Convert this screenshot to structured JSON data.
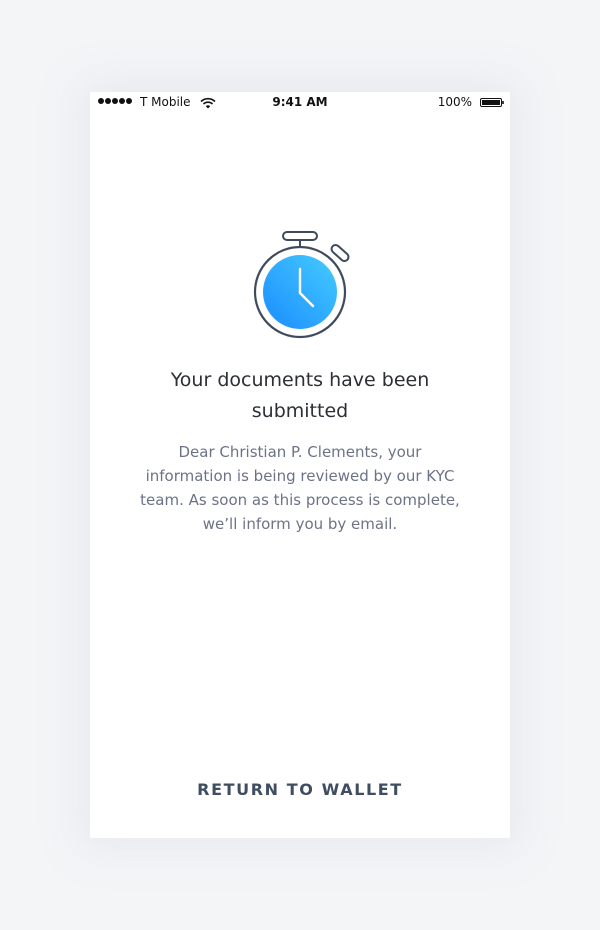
{
  "status_bar": {
    "carrier": "T Mobile",
    "time": "9:41 AM",
    "battery_percent": "100%"
  },
  "icons": {
    "signal": "signal-dots-icon",
    "wifi": "wifi-icon",
    "battery": "battery-icon",
    "hero": "stopwatch-icon"
  },
  "colors": {
    "accent_gradient_start": "#3cc6ff",
    "accent_gradient_end": "#1a8cff",
    "icon_stroke": "#3f4b5c"
  },
  "content": {
    "title": "Your documents have been submitted",
    "message": "Dear Christian P. Clements, your information is being reviewed by our KYC team. As soon as this process is complete, we’ll inform you by email."
  },
  "actions": {
    "return_label": "RETURN TO WALLET"
  }
}
